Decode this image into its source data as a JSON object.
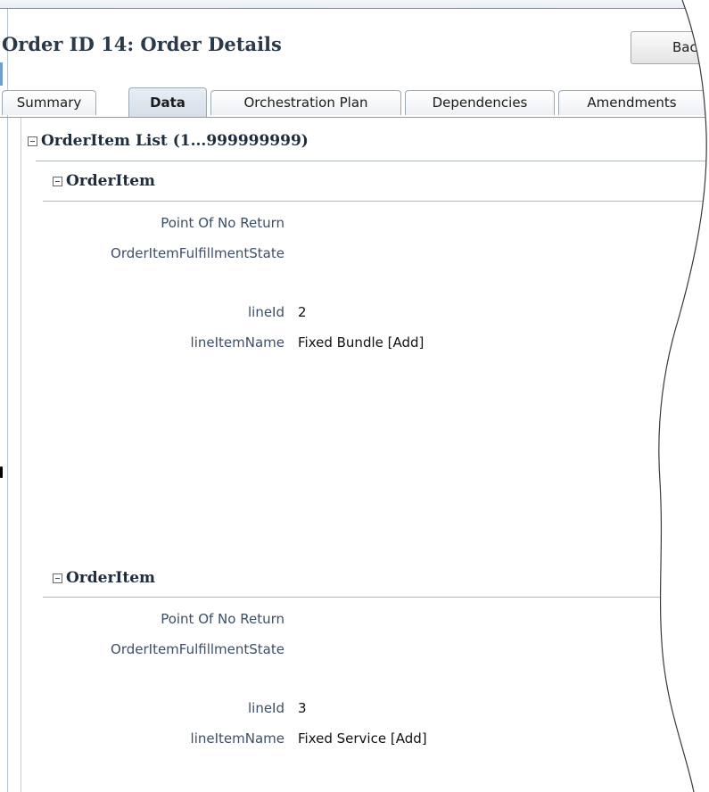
{
  "page": {
    "title": "Order ID 14: Order Details",
    "back_button": "Bac"
  },
  "tabs": [
    {
      "label": "Summary",
      "active": false
    },
    {
      "label": "Data",
      "active": true
    },
    {
      "label": "Orchestration Plan",
      "active": false
    },
    {
      "label": "Dependencies",
      "active": false
    },
    {
      "label": "Amendments",
      "active": false
    }
  ],
  "list": {
    "title": "OrderItem List (1...999999999)"
  },
  "items": [
    {
      "header": "OrderItem",
      "fields": [
        {
          "label": "Point Of No Return",
          "value": ""
        },
        {
          "label": "OrderItemFulfillmentState",
          "value": ""
        },
        {
          "label": "lineId",
          "value": "2"
        },
        {
          "label": "lineItemName",
          "value": "Fixed Bundle [Add]"
        }
      ]
    },
    {
      "header": "OrderItem",
      "fields": [
        {
          "label": "Point Of No Return",
          "value": ""
        },
        {
          "label": "OrderItemFulfillmentState",
          "value": ""
        },
        {
          "label": "lineId",
          "value": "3"
        },
        {
          "label": "lineItemName",
          "value": "Fixed Service [Add]"
        }
      ]
    }
  ]
}
